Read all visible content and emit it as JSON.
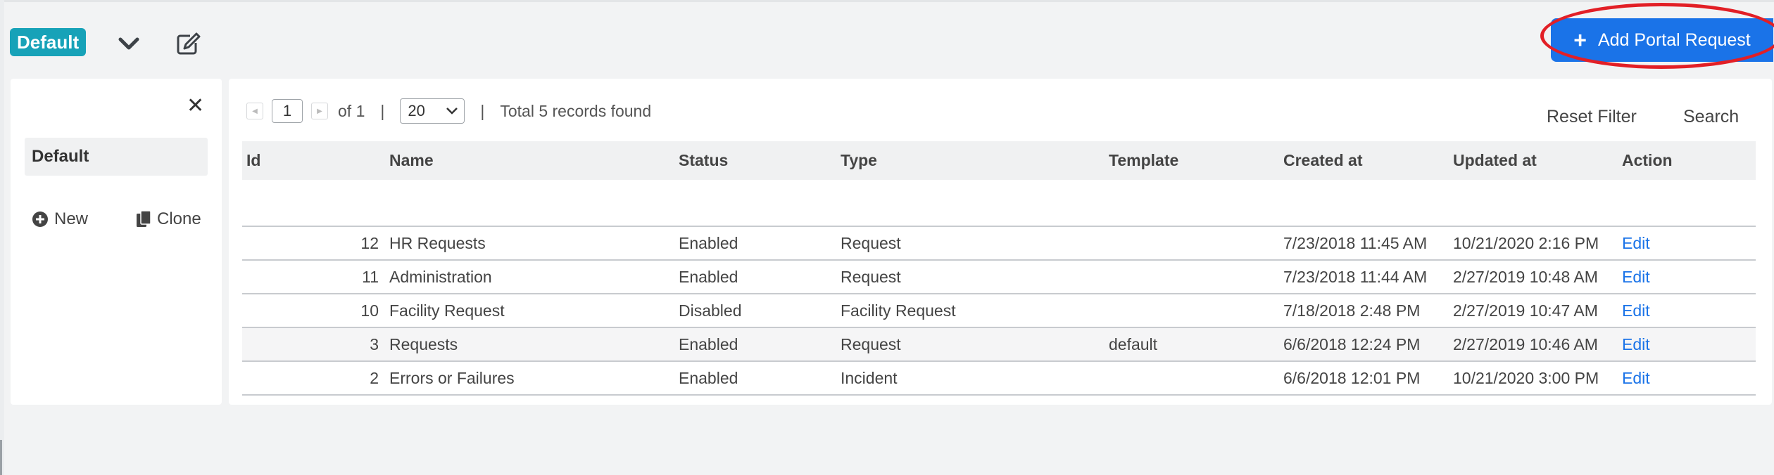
{
  "header": {
    "view_name": "Default",
    "add_button_label": "Add Portal Request",
    "icons": {
      "chevron": "chevron-down-icon",
      "edit": "edit-icon",
      "add": "plus-icon"
    }
  },
  "sidebar": {
    "close_icon": "close-icon",
    "items": [
      {
        "label": "Default"
      }
    ],
    "new_label": "New",
    "clone_label": "Clone"
  },
  "pagination": {
    "current_page": "1",
    "of_text": "of 1",
    "separator": "|",
    "page_size": "20",
    "total_text": "Total 5 records found"
  },
  "toolbar": {
    "reset_filter": "Reset Filter",
    "search": "Search"
  },
  "table": {
    "columns": [
      "Id",
      "Name",
      "Status",
      "Type",
      "Template",
      "Created at",
      "Updated at",
      "Action"
    ],
    "rows": [
      {
        "id": "12",
        "name": "HR Requests",
        "status": "Enabled",
        "type": "Request",
        "template": "",
        "created": "7/23/2018 11:45 AM",
        "updated": "10/21/2020 2:16 PM",
        "action": "Edit"
      },
      {
        "id": "11",
        "name": "Administration",
        "status": "Enabled",
        "type": "Request",
        "template": "",
        "created": "7/23/2018 11:44 AM",
        "updated": "2/27/2019 10:48 AM",
        "action": "Edit"
      },
      {
        "id": "10",
        "name": "Facility Request",
        "status": "Disabled",
        "type": "Facility Request",
        "template": "",
        "created": "7/18/2018 2:48 PM",
        "updated": "2/27/2019 10:47 AM",
        "action": "Edit"
      },
      {
        "id": "3",
        "name": "Requests",
        "status": "Enabled",
        "type": "Request",
        "template": "default",
        "created": "6/6/2018 12:24 PM",
        "updated": "2/27/2019 10:46 AM",
        "action": "Edit"
      },
      {
        "id": "2",
        "name": "Errors or Failures",
        "status": "Enabled",
        "type": "Incident",
        "template": "",
        "created": "6/6/2018 12:01 PM",
        "updated": "10/21/2020 3:00 PM",
        "action": "Edit"
      }
    ]
  },
  "colors": {
    "badge": "#17a2b8",
    "primary": "#1a73e8",
    "highlight": "#e21f26",
    "background": "#f2f3f4"
  }
}
